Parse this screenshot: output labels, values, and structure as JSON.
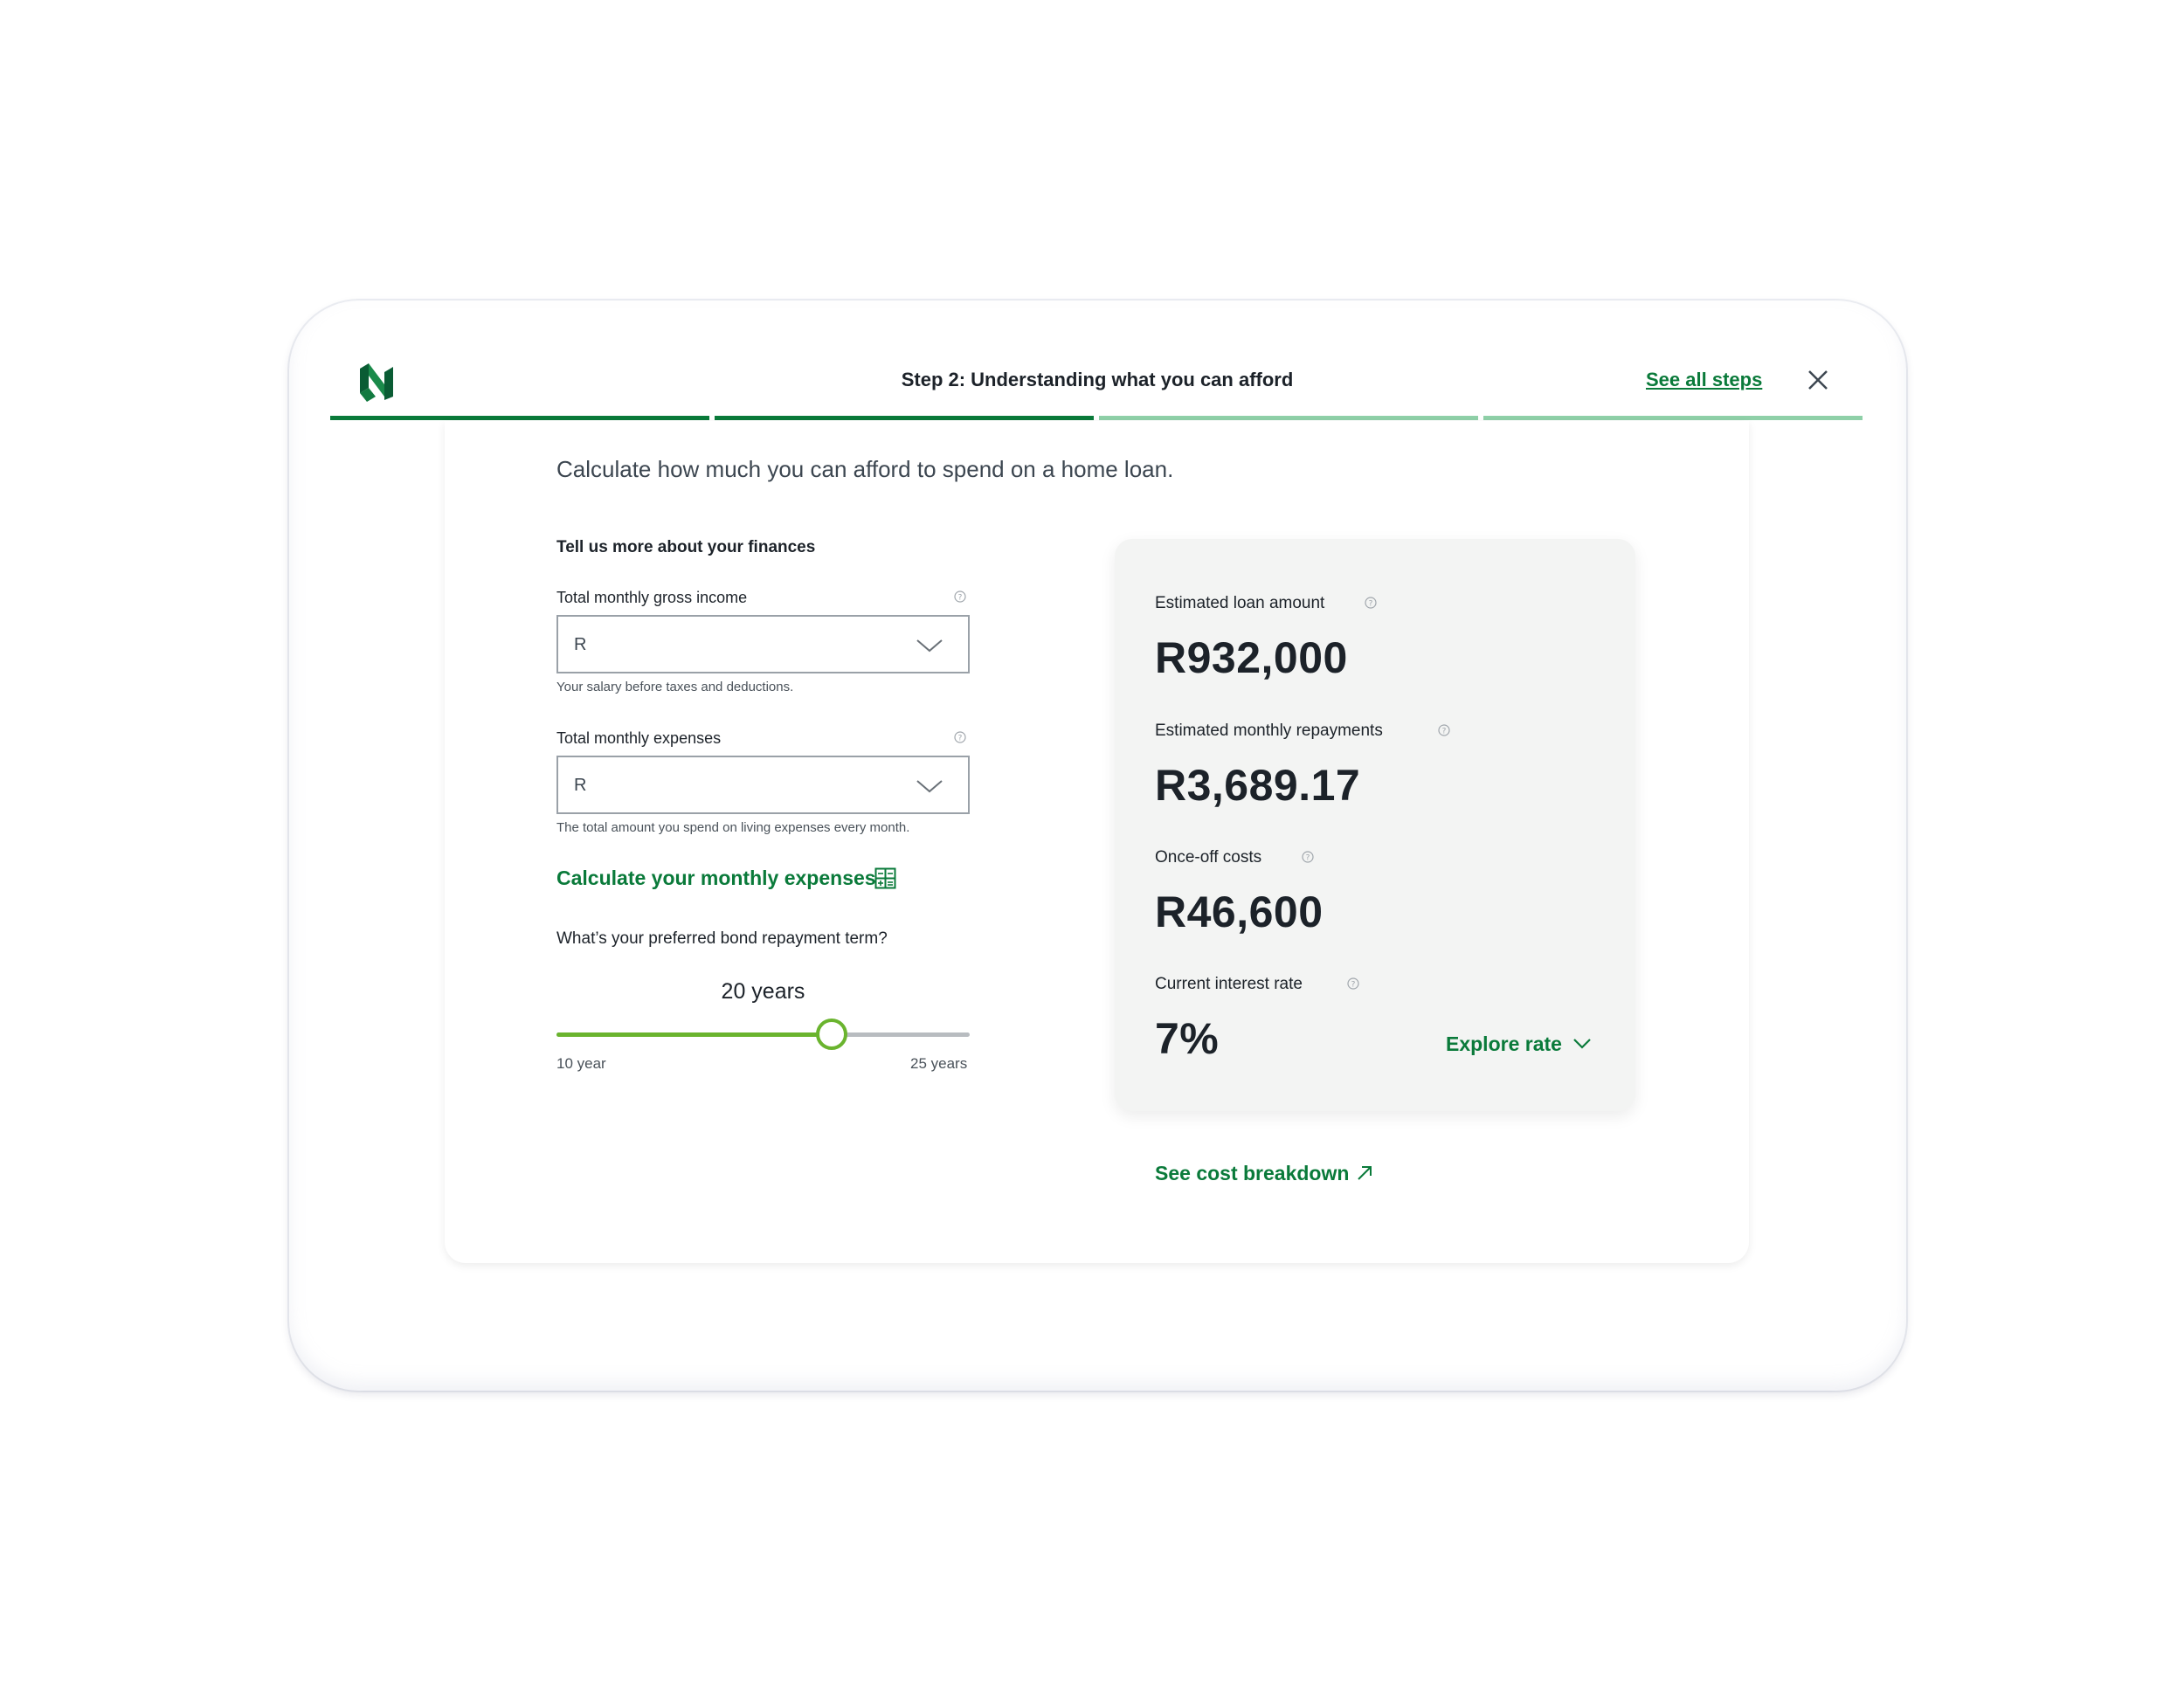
{
  "header": {
    "step_title": "Step 2: Understanding what you can afford",
    "see_all_steps": "See all steps",
    "progress": [
      {
        "state": "done",
        "color": "#0a7a3a"
      },
      {
        "state": "done",
        "color": "#0a7a3a"
      },
      {
        "state": "upcoming",
        "color": "#8fd0a8"
      },
      {
        "state": "upcoming",
        "color": "#8fd0a8"
      }
    ]
  },
  "intro": "Calculate how much you can afford to spend on a home loan.",
  "form": {
    "section_title": "Tell us more about your finances",
    "income": {
      "label": "Total monthly gross income",
      "prefix": "R",
      "hint": "Your salary before taxes and deductions."
    },
    "expenses": {
      "label": "Total monthly expenses",
      "prefix": "R",
      "hint": "The total amount you spend on living expenses every month."
    },
    "calc_link": "Calculate your monthly expenses",
    "term_question": "What’s your preferred bond repayment term?",
    "term_value": "20 years",
    "slider": {
      "min_label": "10 year",
      "max_label": "25 years",
      "min": 10,
      "max": 25,
      "value": 20
    }
  },
  "results": {
    "loan_label": "Estimated loan amount",
    "loan_value": "R932,000",
    "repay_label": "Estimated monthly repayments",
    "repay_value": "R3,689.17",
    "costs_label": "Once-off costs",
    "costs_value": "R46,600",
    "rate_label": "Current interest rate",
    "rate_value": "7%",
    "explore_rate": "Explore rate"
  },
  "breakdown_link": "See cost breakdown",
  "colors": {
    "brand_green": "#0a7a3a",
    "slider_green": "#6ab42e",
    "panel_bg": "#f3f4f3"
  }
}
